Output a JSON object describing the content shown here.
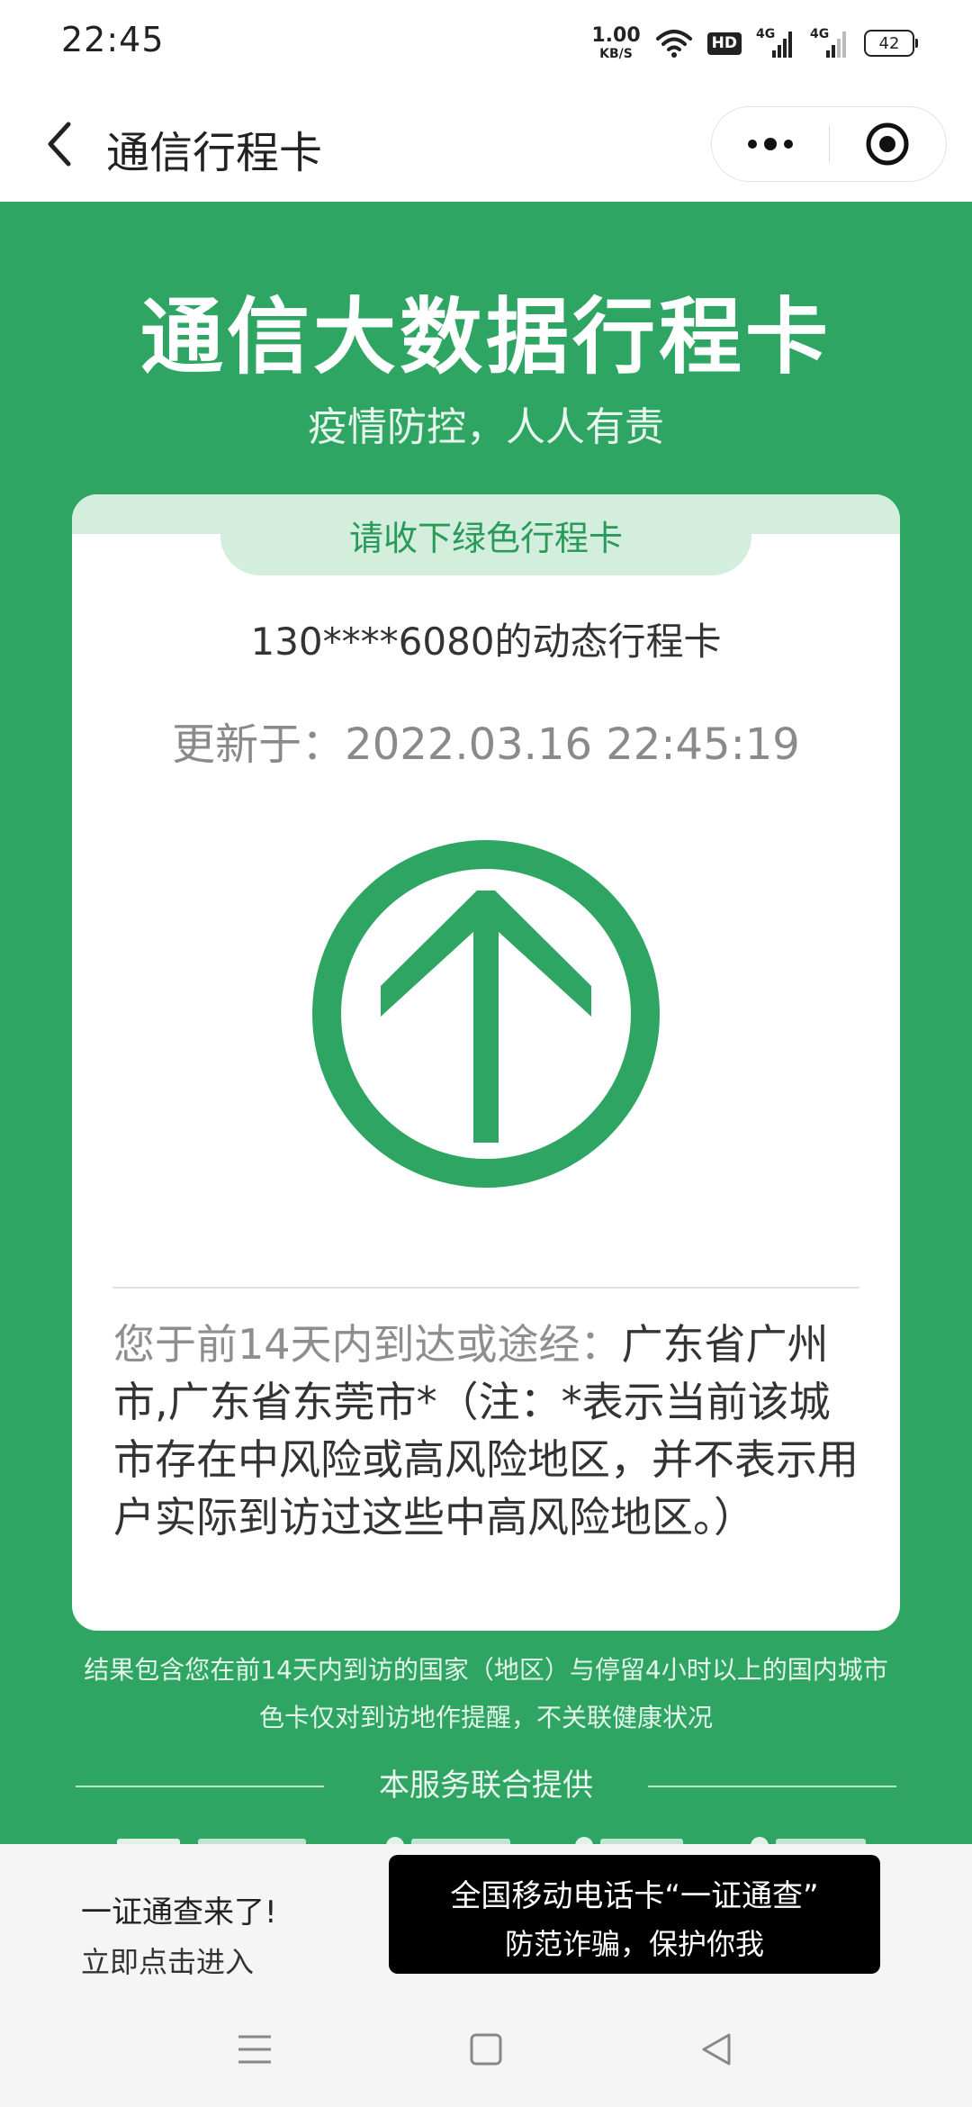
{
  "status_bar": {
    "time": "22:45",
    "net_speed_value": "1.00",
    "net_speed_unit": "KB/S",
    "hd_label": "HD",
    "signal_1_label": "4G",
    "signal_2_label": "4G",
    "battery_level": "42"
  },
  "nav": {
    "title": "通信行程卡"
  },
  "header": {
    "title": "通信大数据行程卡",
    "subtitle": "疫情防控，人人有责"
  },
  "card": {
    "tab_label": "请收下绿色行程卡",
    "phone_line": "130****6080的动态行程卡",
    "updated_line": "更新于：2022.03.16 22:45:19",
    "trip_prefix": "您于前14天内到达或途经：",
    "trip_content": "广东省广州市,广东省东莞市*（注：*表示当前该城市存在中风险或高风险地区，并不表示用户实际到访过这些中高风险地区。）",
    "status_color": "#2ea562"
  },
  "footnotes": {
    "line1": "结果包含您在前14天内到访的国家（地区）与停留4小时以上的国内城市",
    "line2": "色卡仅对到访地作提醒，不关联健康状况",
    "service": "本服务联合提供"
  },
  "banner": {
    "left_title": "一证通查来了!",
    "left_sub": "立即点击进入",
    "button_line1": "全国移动电话卡“一证通查”",
    "button_line2": "防范诈骗，保护你我"
  },
  "icons": {
    "back": "chevron-left-icon",
    "more": "more-dots-icon",
    "close": "target-close-icon",
    "wifi": "wifi-icon",
    "arrow": "up-arrow-circle-icon",
    "menu": "menu-lines-icon",
    "home": "square-home-icon",
    "back_nav": "triangle-back-icon"
  }
}
